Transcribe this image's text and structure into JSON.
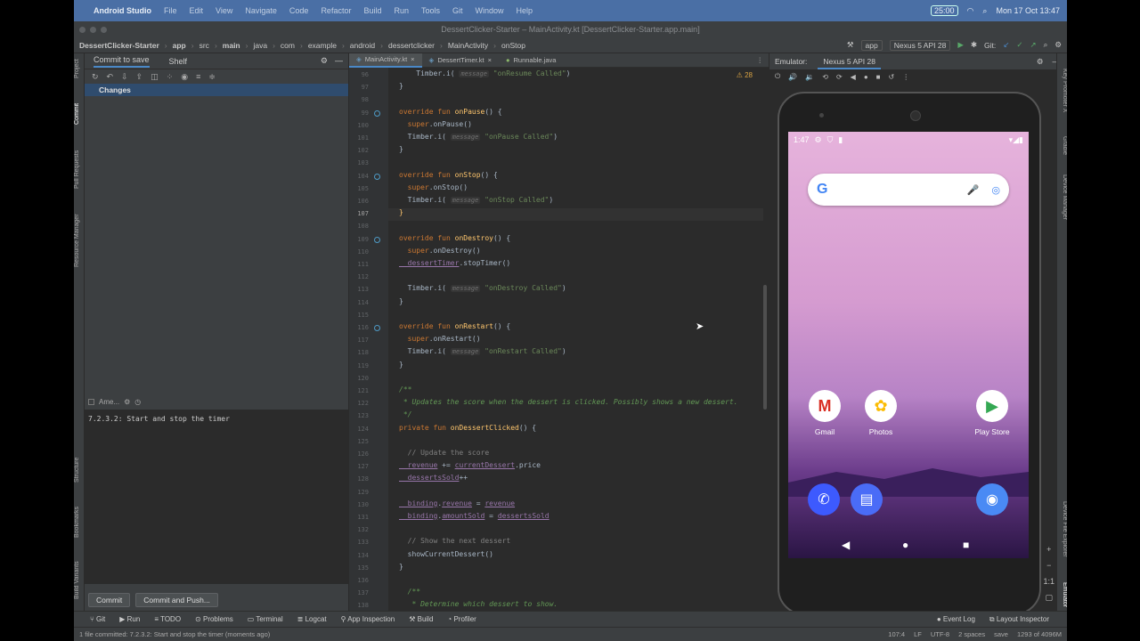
{
  "os": {
    "app": "Android Studio",
    "menus": [
      "File",
      "Edit",
      "View",
      "Navigate",
      "Code",
      "Refactor",
      "Build",
      "Run",
      "Tools",
      "Git",
      "Window",
      "Help"
    ],
    "timer": "25:00",
    "clock": "Mon 17 Oct  13:47"
  },
  "window_title": "DessertClicker-Starter – MainActivity.kt [DessertClicker-Starter.app.main]",
  "breadcrumb": [
    "DessertClicker-Starter",
    "app",
    "src",
    "main",
    "java",
    "com",
    "example",
    "android",
    "dessertclicker",
    "MainActivity",
    "onStop"
  ],
  "run_config": "app",
  "device": "Nexus 5 API 28",
  "git_label": "Git:",
  "left_tools": [
    "Project",
    "Commit",
    "Pull Requests",
    "Resource Manager",
    "Structure",
    "Bookmarks",
    "Build Variants"
  ],
  "commit_panel": {
    "tabs": [
      "Commit to save",
      "Shelf"
    ],
    "changes": "Changes",
    "amend": "Ame...",
    "message": "7.2.3.2: Start and stop the timer",
    "commit": "Commit",
    "commit_push": "Commit and Push..."
  },
  "editor": {
    "tabs": [
      "MainActivity.kt",
      "DessertTimer.kt",
      "Runnable.java"
    ],
    "warnings": "28",
    "lines": [
      {
        "n": "96",
        "parts": [
          [
            "",
            "    Timber.i( "
          ],
          [
            "hint",
            "message"
          ],
          [
            "st",
            " \"onResume Called\""
          ],
          [
            "",
            ")"
          ]
        ]
      },
      {
        "n": "97",
        "parts": [
          [
            "",
            "}"
          ]
        ]
      },
      {
        "n": "98",
        "parts": []
      },
      {
        "n": "99",
        "parts": [
          [
            "kw",
            "override fun "
          ],
          [
            "fn",
            "onPause"
          ],
          [
            "",
            "() {"
          ]
        ]
      },
      {
        "n": "100",
        "parts": [
          [
            "kw",
            "  super"
          ],
          [
            "",
            ".onPause()"
          ]
        ]
      },
      {
        "n": "101",
        "parts": [
          [
            "",
            "  Timber.i( "
          ],
          [
            "hint",
            "message"
          ],
          [
            "st",
            " \"onPause Called\""
          ],
          [
            "",
            ")"
          ]
        ]
      },
      {
        "n": "102",
        "parts": [
          [
            "",
            "}"
          ]
        ]
      },
      {
        "n": "103",
        "parts": []
      },
      {
        "n": "104",
        "parts": [
          [
            "kw",
            "override fun "
          ],
          [
            "fn",
            "onStop"
          ],
          [
            "",
            "() {"
          ]
        ]
      },
      {
        "n": "105",
        "parts": [
          [
            "kw",
            "  super"
          ],
          [
            "",
            ".onStop()"
          ]
        ]
      },
      {
        "n": "106",
        "parts": [
          [
            "",
            "  Timber.i( "
          ],
          [
            "hint",
            "message"
          ],
          [
            "st",
            " \"onStop Called\""
          ],
          [
            "",
            ")"
          ]
        ]
      },
      {
        "n": "107",
        "parts": [
          [
            "fn",
            "}"
          ]
        ]
      },
      {
        "n": "108",
        "parts": []
      },
      {
        "n": "109",
        "parts": [
          [
            "kw",
            "override fun "
          ],
          [
            "fn",
            "onDestroy"
          ],
          [
            "",
            "() {"
          ]
        ]
      },
      {
        "n": "110",
        "parts": [
          [
            "kw",
            "  super"
          ],
          [
            "",
            ".onDestroy()"
          ]
        ]
      },
      {
        "n": "111",
        "parts": [
          [
            "pr",
            "  dessertTimer"
          ],
          [
            "",
            ".stopTimer()"
          ]
        ]
      },
      {
        "n": "112",
        "parts": []
      },
      {
        "n": "113",
        "parts": [
          [
            "",
            "  Timber.i( "
          ],
          [
            "hint",
            "message"
          ],
          [
            "st",
            " \"onDestroy Called\""
          ],
          [
            "",
            ")"
          ]
        ]
      },
      {
        "n": "114",
        "parts": [
          [
            "",
            "}"
          ]
        ]
      },
      {
        "n": "115",
        "parts": []
      },
      {
        "n": "116",
        "parts": [
          [
            "kw",
            "override fun "
          ],
          [
            "fn",
            "onRestart"
          ],
          [
            "",
            "() {"
          ]
        ]
      },
      {
        "n": "117",
        "parts": [
          [
            "kw",
            "  super"
          ],
          [
            "",
            ".onRestart()"
          ]
        ]
      },
      {
        "n": "118",
        "parts": [
          [
            "",
            "  Timber.i( "
          ],
          [
            "hint",
            "message"
          ],
          [
            "st",
            " \"onRestart Called\""
          ],
          [
            "",
            ")"
          ]
        ]
      },
      {
        "n": "119",
        "parts": [
          [
            "",
            "}"
          ]
        ]
      },
      {
        "n": "120",
        "parts": []
      },
      {
        "n": "121",
        "parts": [
          [
            "cm",
            "/**"
          ]
        ]
      },
      {
        "n": "122",
        "parts": [
          [
            "cm",
            " * Updates the score when the dessert is clicked. Possibly shows a new dessert."
          ]
        ]
      },
      {
        "n": "123",
        "parts": [
          [
            "cm",
            " */"
          ]
        ]
      },
      {
        "n": "124",
        "parts": [
          [
            "kw",
            "private fun "
          ],
          [
            "fn",
            "onDessertClicked"
          ],
          [
            "",
            "() {"
          ]
        ]
      },
      {
        "n": "125",
        "parts": []
      },
      {
        "n": "126",
        "parts": [
          [
            "cmg",
            "  // Update the score"
          ]
        ]
      },
      {
        "n": "127",
        "parts": [
          [
            "pr",
            "  revenue"
          ],
          [
            "",
            " += "
          ],
          [
            "pr",
            "currentDessert"
          ],
          [
            "",
            ".price"
          ]
        ]
      },
      {
        "n": "128",
        "parts": [
          [
            "pr",
            "  dessertsSold"
          ],
          [
            "",
            "++"
          ]
        ]
      },
      {
        "n": "129",
        "parts": []
      },
      {
        "n": "130",
        "parts": [
          [
            "pr",
            "  binding"
          ],
          [
            "",
            "."
          ],
          [
            "pr",
            "revenue"
          ],
          [
            "",
            " = "
          ],
          [
            "pr",
            "revenue"
          ]
        ]
      },
      {
        "n": "131",
        "parts": [
          [
            "pr",
            "  binding"
          ],
          [
            "",
            "."
          ],
          [
            "pr",
            "amountSold"
          ],
          [
            "",
            " = "
          ],
          [
            "pr",
            "dessertsSold"
          ]
        ]
      },
      {
        "n": "132",
        "parts": []
      },
      {
        "n": "133",
        "parts": [
          [
            "cmg",
            "  // Show the next dessert"
          ]
        ]
      },
      {
        "n": "134",
        "parts": [
          [
            "",
            "  showCurrentDessert()"
          ]
        ]
      },
      {
        "n": "135",
        "parts": [
          [
            "",
            "}"
          ]
        ]
      },
      {
        "n": "136",
        "parts": []
      },
      {
        "n": "137",
        "parts": [
          [
            "cm",
            "  /**"
          ]
        ]
      },
      {
        "n": "138",
        "parts": [
          [
            "cm",
            "   * Determine which dessert to show."
          ]
        ]
      }
    ]
  },
  "emulator": {
    "label": "Emulator:",
    "device": "Nexus 5 API 28",
    "time": "1:47",
    "apps": [
      "Gmail",
      "Photos",
      "Play Store"
    ],
    "zoom": "1:1"
  },
  "right_tools": [
    "Key Promoter X",
    "Gradle",
    "Device Manager",
    "Device File Explorer",
    "Emulator"
  ],
  "bottom_tools": [
    "Git",
    "Run",
    "TODO",
    "Problems",
    "Terminal",
    "Logcat",
    "App Inspection",
    "Build",
    "Profiler"
  ],
  "bottom_right": [
    "Event Log",
    "Layout Inspector"
  ],
  "status": {
    "message": "1 file committed: 7.2.3.2: Start and stop the timer (moments ago)",
    "pos": "107:4",
    "lf": "LF",
    "enc": "UTF-8",
    "indent": "2 spaces",
    "save": "save",
    "mem": "1293 of 4096M"
  }
}
